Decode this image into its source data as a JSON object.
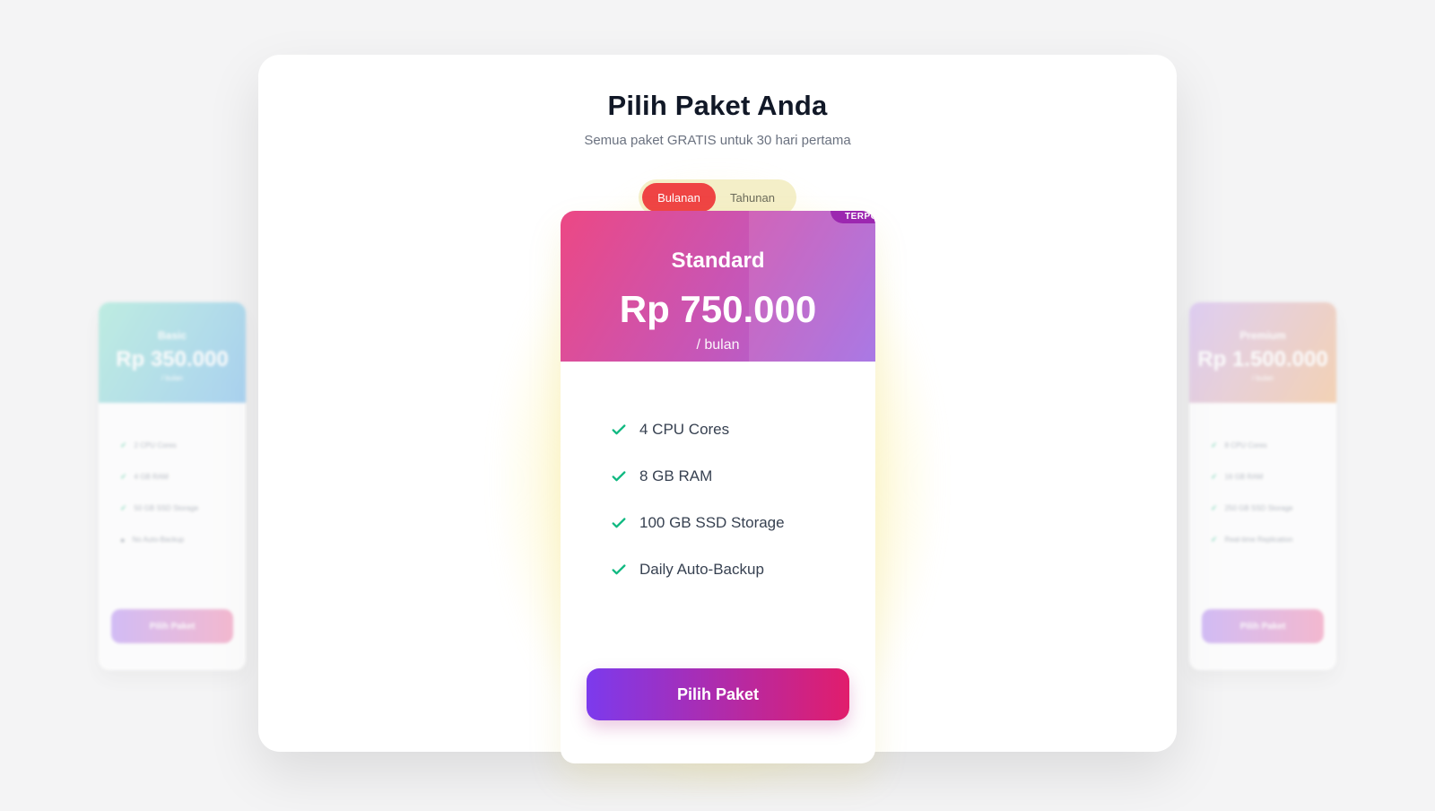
{
  "header": {
    "title": "Pilih Paket Anda",
    "subtitle": "Semua paket GRATIS untuk 30 hari pertama"
  },
  "billing_toggle": {
    "options": [
      "Bulanan",
      "Tahunan"
    ],
    "selected": "Bulanan"
  },
  "plans": [
    {
      "name": "Basic",
      "price": "Rp 350.000",
      "period": "/ bulan",
      "features": [
        {
          "label": "2 CPU Cores",
          "included": true
        },
        {
          "label": "4 GB RAM",
          "included": true
        },
        {
          "label": "50 GB SSD Storage",
          "included": true
        },
        {
          "label": "No Auto-Backup",
          "included": false
        }
      ],
      "button": "Pilih Paket"
    },
    {
      "name": "Standard",
      "badge": "TERPOPULER",
      "price": "Rp 750.000",
      "period": "/ bulan",
      "features": [
        {
          "label": "4 CPU Cores",
          "included": true
        },
        {
          "label": "8 GB RAM",
          "included": true
        },
        {
          "label": "100 GB SSD Storage",
          "included": true
        },
        {
          "label": "Daily Auto-Backup",
          "included": true
        }
      ],
      "button": "Pilih Paket"
    },
    {
      "name": "Premium",
      "price": "Rp 1.500.000",
      "period": "/ bulan",
      "features": [
        {
          "label": "8 CPU Cores",
          "included": true
        },
        {
          "label": "16 GB RAM",
          "included": true
        },
        {
          "label": "250 GB SSD Storage",
          "included": true
        },
        {
          "label": "Real-time Replication",
          "included": true
        }
      ],
      "button": "Pilih Paket"
    }
  ],
  "colors": {
    "toggle_active": "#ef4444",
    "check": "#10b981",
    "cta_start": "#7c3aed",
    "cta_end": "#e11d6c"
  }
}
